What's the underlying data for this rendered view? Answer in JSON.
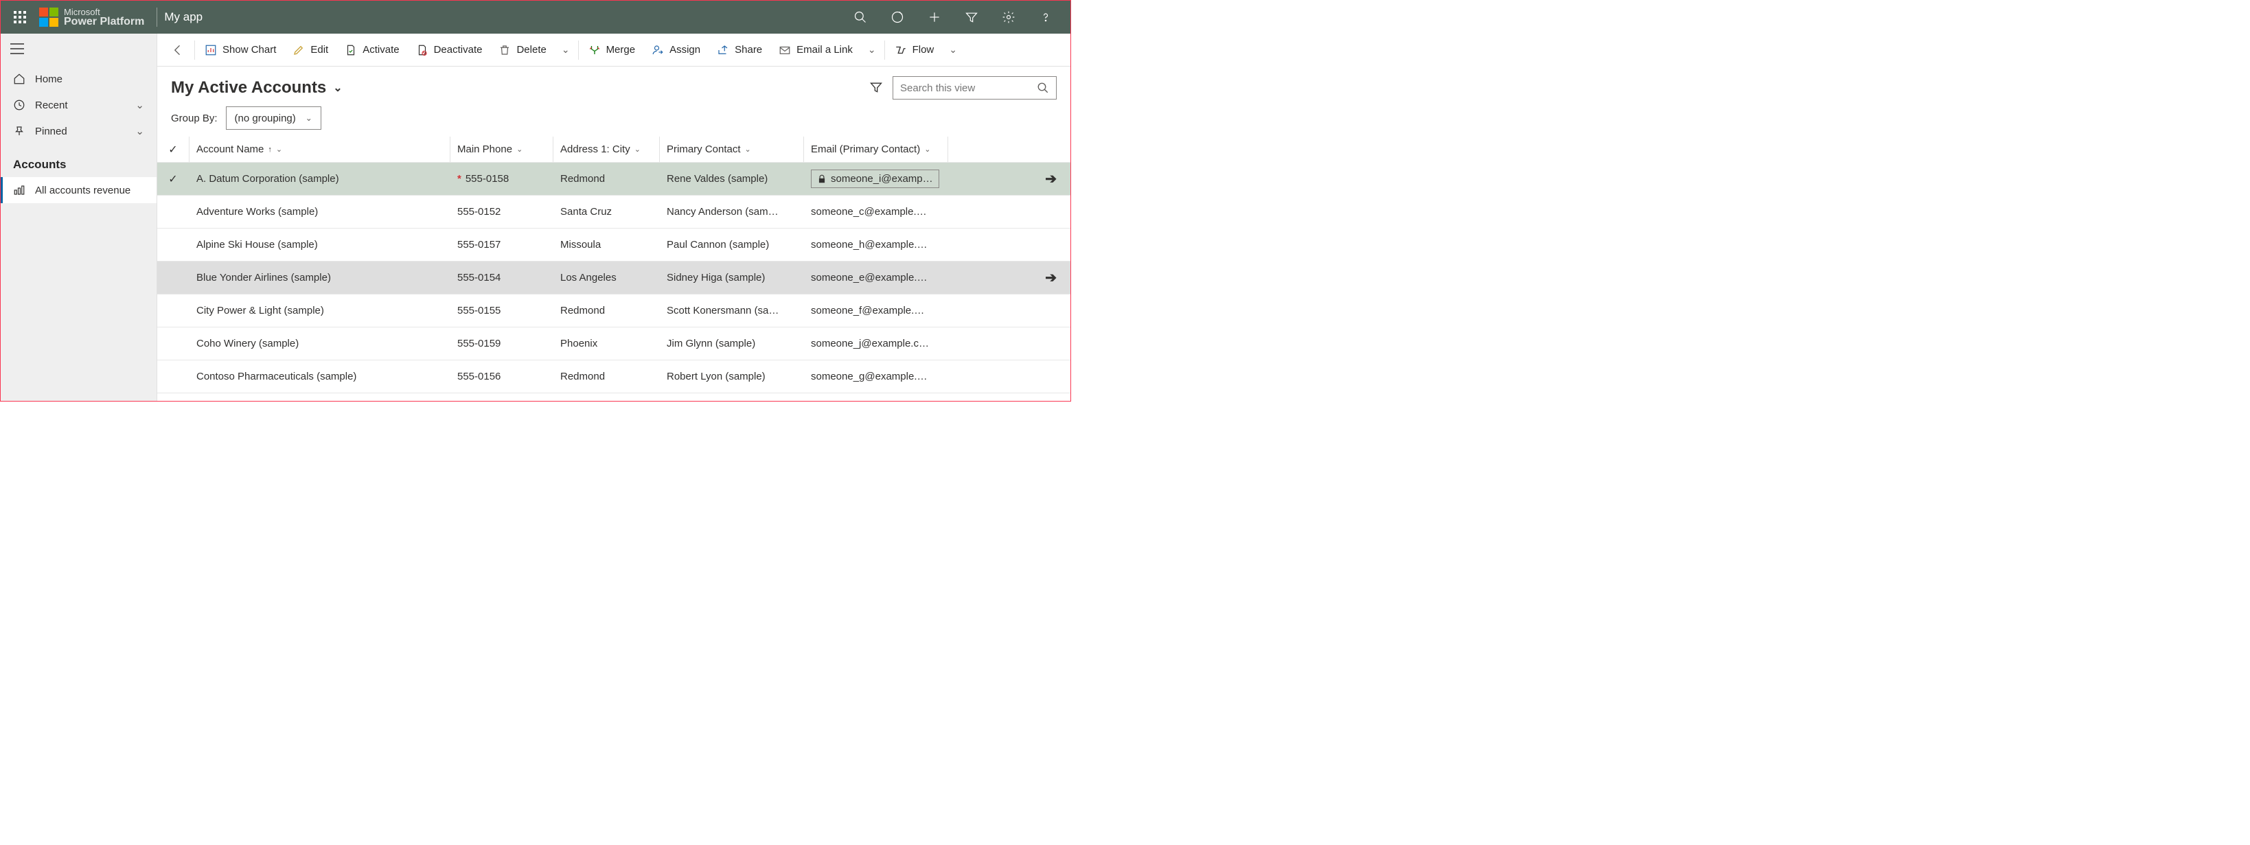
{
  "header": {
    "brand_l1": "Microsoft",
    "brand_l2": "Power Platform",
    "app_name": "My app"
  },
  "sidebar": {
    "home": "Home",
    "recent": "Recent",
    "pinned": "Pinned",
    "section": "Accounts",
    "item_revenue": "All accounts revenue"
  },
  "cmdbar": {
    "show_chart": "Show Chart",
    "edit": "Edit",
    "activate": "Activate",
    "deactivate": "Deactivate",
    "delete": "Delete",
    "merge": "Merge",
    "assign": "Assign",
    "share": "Share",
    "email_link": "Email a Link",
    "flow": "Flow"
  },
  "view": {
    "title": "My Active Accounts",
    "search_placeholder": "Search this view",
    "groupby_label": "Group By:",
    "groupby_value": "(no grouping)"
  },
  "columns": {
    "name": "Account Name",
    "phone": "Main Phone",
    "city": "Address 1: City",
    "contact": "Primary Contact",
    "email": "Email (Primary Contact)"
  },
  "rows": [
    {
      "name": "A. Datum Corporation (sample)",
      "phone": "555-0158",
      "city": "Redmond",
      "contact": "Rene Valdes (sample)",
      "email": "someone_i@examp…",
      "selected": true,
      "required": true,
      "locked": true,
      "arrow": true
    },
    {
      "name": "Adventure Works (sample)",
      "phone": "555-0152",
      "city": "Santa Cruz",
      "contact": "Nancy Anderson (sam…",
      "email": "someone_c@example.…"
    },
    {
      "name": "Alpine Ski House (sample)",
      "phone": "555-0157",
      "city": "Missoula",
      "contact": "Paul Cannon (sample)",
      "email": "someone_h@example.…"
    },
    {
      "name": "Blue Yonder Airlines (sample)",
      "phone": "555-0154",
      "city": "Los Angeles",
      "contact": "Sidney Higa (sample)",
      "email": "someone_e@example.…",
      "hover": true,
      "arrow": true
    },
    {
      "name": "City Power & Light (sample)",
      "phone": "555-0155",
      "city": "Redmond",
      "contact": "Scott Konersmann (sa…",
      "email": "someone_f@example.…"
    },
    {
      "name": "Coho Winery (sample)",
      "phone": "555-0159",
      "city": "Phoenix",
      "contact": "Jim Glynn (sample)",
      "email": "someone_j@example.c…"
    },
    {
      "name": "Contoso Pharmaceuticals (sample)",
      "phone": "555-0156",
      "city": "Redmond",
      "contact": "Robert Lyon (sample)",
      "email": "someone_g@example.…"
    }
  ]
}
